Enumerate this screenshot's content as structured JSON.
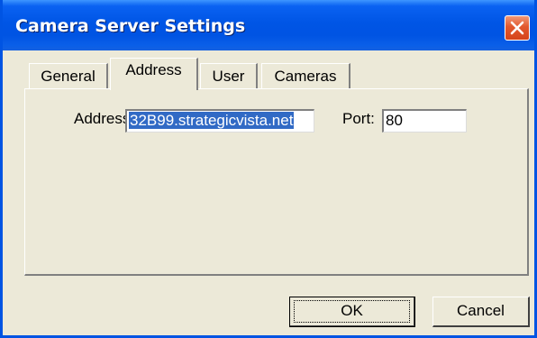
{
  "window": {
    "title": "Camera Server Settings",
    "close_icon": "close-x-icon"
  },
  "tabs": [
    {
      "label": "General",
      "active": false
    },
    {
      "label": "Address",
      "active": true
    },
    {
      "label": "User",
      "active": false
    },
    {
      "label": "Cameras",
      "active": false
    }
  ],
  "address_tab": {
    "address_label": "Address:",
    "address_value": "32B99.strategicvista.net",
    "port_label": "Port:",
    "port_value": "80"
  },
  "buttons": {
    "ok_label": "OK",
    "cancel_label": "Cancel"
  },
  "colors": {
    "titlebar": "#0054e3",
    "close_button": "#e2582d",
    "selection": "#316ac5",
    "face": "#ece9d8"
  }
}
